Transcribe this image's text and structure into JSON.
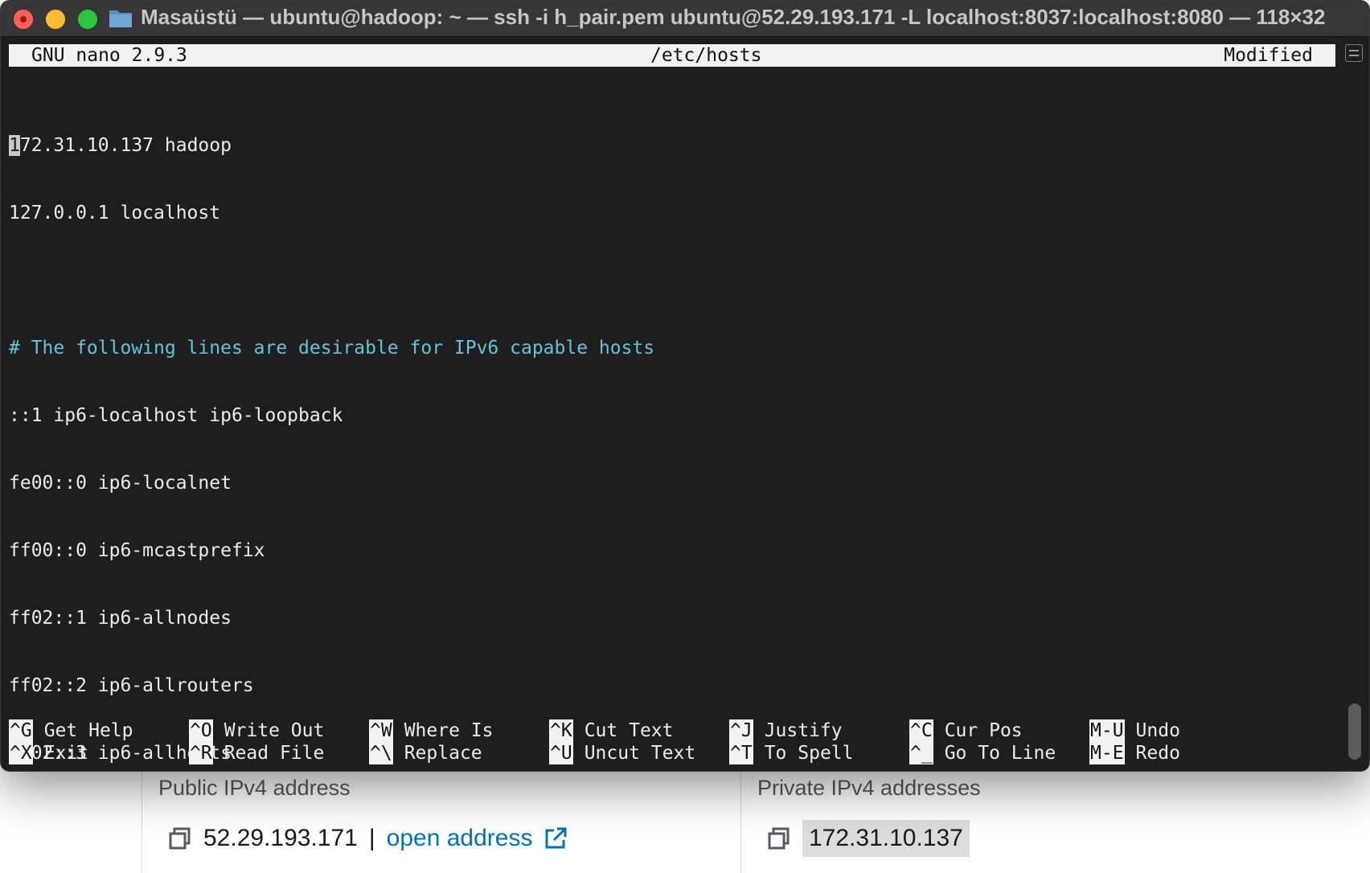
{
  "window": {
    "title": "Masaüstü — ubuntu@hadoop: ~ — ssh -i h_pair.pem ubuntu@52.29.193.171 -L localhost:8037:localhost:8080 — 118×32"
  },
  "nano": {
    "version": "GNU nano 2.9.3",
    "filename": "/etc/hosts",
    "status": "Modified",
    "cursor_char": "1",
    "first_line_rest": "72.31.10.137 hadoop",
    "lines": [
      "127.0.0.1 localhost",
      "",
      "# The following lines are desirable for IPv6 capable hosts",
      "::1 ip6-localhost ip6-loopback",
      "fe00::0 ip6-localnet",
      "ff00::0 ip6-mcastprefix",
      "ff02::1 ip6-allnodes",
      "ff02::2 ip6-allrouters",
      "ff02::3 ip6-allhosts"
    ],
    "shortcuts": [
      {
        "key1": "^G",
        "label1": "Get Help",
        "key2": "^X",
        "label2": "Exit"
      },
      {
        "key1": "^O",
        "label1": "Write Out",
        "key2": "^R",
        "label2": "Read File"
      },
      {
        "key1": "^W",
        "label1": "Where Is",
        "key2": "^\\",
        "label2": "Replace"
      },
      {
        "key1": "^K",
        "label1": "Cut Text",
        "key2": "^U",
        "label2": "Uncut Text"
      },
      {
        "key1": "^J",
        "label1": "Justify",
        "key2": "^T",
        "label2": "To Spell"
      },
      {
        "key1": "^C",
        "label1": "Cur Pos",
        "key2": "^_",
        "label2": "Go To Line"
      },
      {
        "key1": "M-U",
        "label1": "Undo",
        "key2": "M-E",
        "label2": "Redo"
      }
    ]
  },
  "console": {
    "public_label": "Public IPv4 address",
    "public_ip": "52.29.193.171",
    "separator": "|",
    "open_address": "open address",
    "private_label": "Private IPv4 addresses",
    "private_ip": "172.31.10.137"
  },
  "colors": {
    "terminal_bg": "#1e1e1e",
    "comment": "#63c5d9",
    "link": "#0073bb"
  }
}
